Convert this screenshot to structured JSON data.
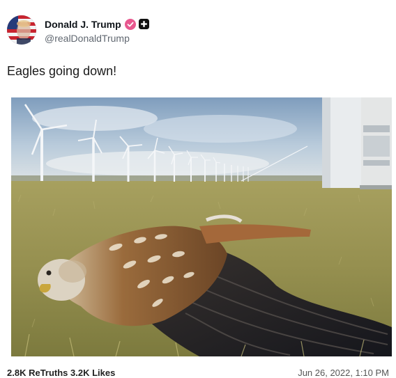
{
  "post": {
    "author": {
      "display_name": "Donald J. Trump",
      "handle": "@realDonaldTrump",
      "avatar_icon": "flag-portrait-avatar",
      "verified_icon": "verified-badge-icon",
      "badge_icon": "plus-badge-icon",
      "verified_color": "#e8588f"
    },
    "text": "Eagles going down!",
    "media": {
      "kind": "photo",
      "subject_icon": "dead-bird-wind-turbines-photo"
    },
    "footer": {
      "left_text": "2.8K  ReTruths  3.2K  Likes",
      "right_text": "Jun 26, 2022, 1:10 PM"
    }
  }
}
